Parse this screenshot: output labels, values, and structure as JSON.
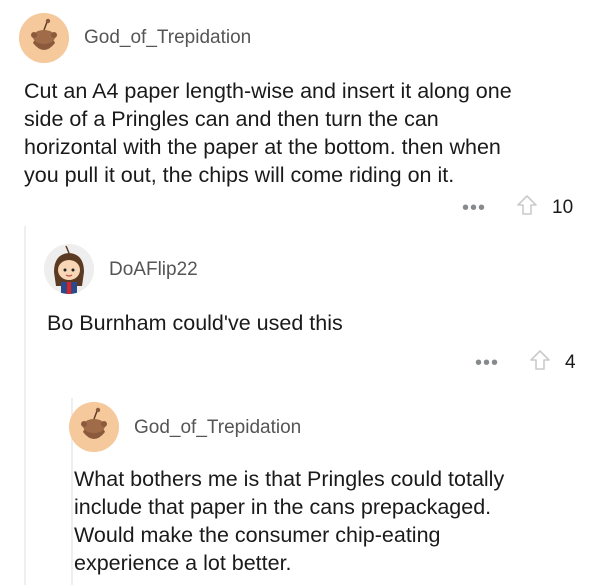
{
  "comments": [
    {
      "username": "God_of_Trepidation",
      "avatar_icon": "snoo-avatar-icon",
      "body_lines": [
        "Cut an A4 paper length-wise and insert it along one",
        "side of a Pringles can and then turn the can",
        "horizontal with the paper at the bottom. then when",
        "you pull it out, the chips will come riding on it."
      ],
      "more_label": "•••",
      "score": "10"
    },
    {
      "username": "DoAFlip22",
      "avatar_icon": "girl-avatar-icon",
      "body_lines": [
        "Bo Burnham could've used this"
      ],
      "more_label": "•••",
      "score": "4"
    },
    {
      "username": "God_of_Trepidation",
      "avatar_icon": "snoo-avatar-icon",
      "body_lines": [
        "What bothers me is that Pringles could totally",
        "include that paper in the cans prepackaged.",
        "Would make the consumer chip-eating",
        "experience a lot better."
      ]
    }
  ],
  "colors": {
    "snoo_bg": "#f5c99b",
    "snoo_body": "#8b5a3c",
    "username": "#555555",
    "meta": "#878a8c",
    "thread_line": "#edeff1"
  }
}
